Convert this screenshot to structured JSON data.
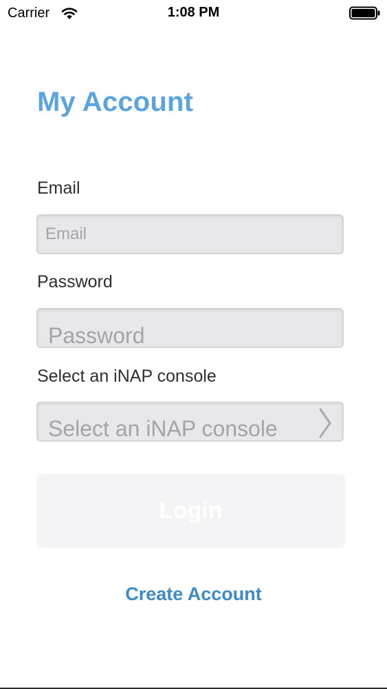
{
  "status_bar": {
    "carrier": "Carrier",
    "time": "1:08 PM",
    "wifi_icon": "wifi-icon",
    "battery_icon": "battery-icon"
  },
  "page": {
    "title": "My Account",
    "title_color": "#5aa5df"
  },
  "form": {
    "email": {
      "label": "Email",
      "placeholder": "Email",
      "value": ""
    },
    "password": {
      "label": "Password",
      "placeholder": "Password",
      "value": ""
    },
    "console": {
      "label": "Select an iNAP console",
      "placeholder": "Select an iNAP console",
      "icon": "chevron-right-icon"
    },
    "login_button": {
      "label": "Login"
    },
    "create_account": {
      "label": "Create Account",
      "color": "#3d8ac8"
    }
  }
}
